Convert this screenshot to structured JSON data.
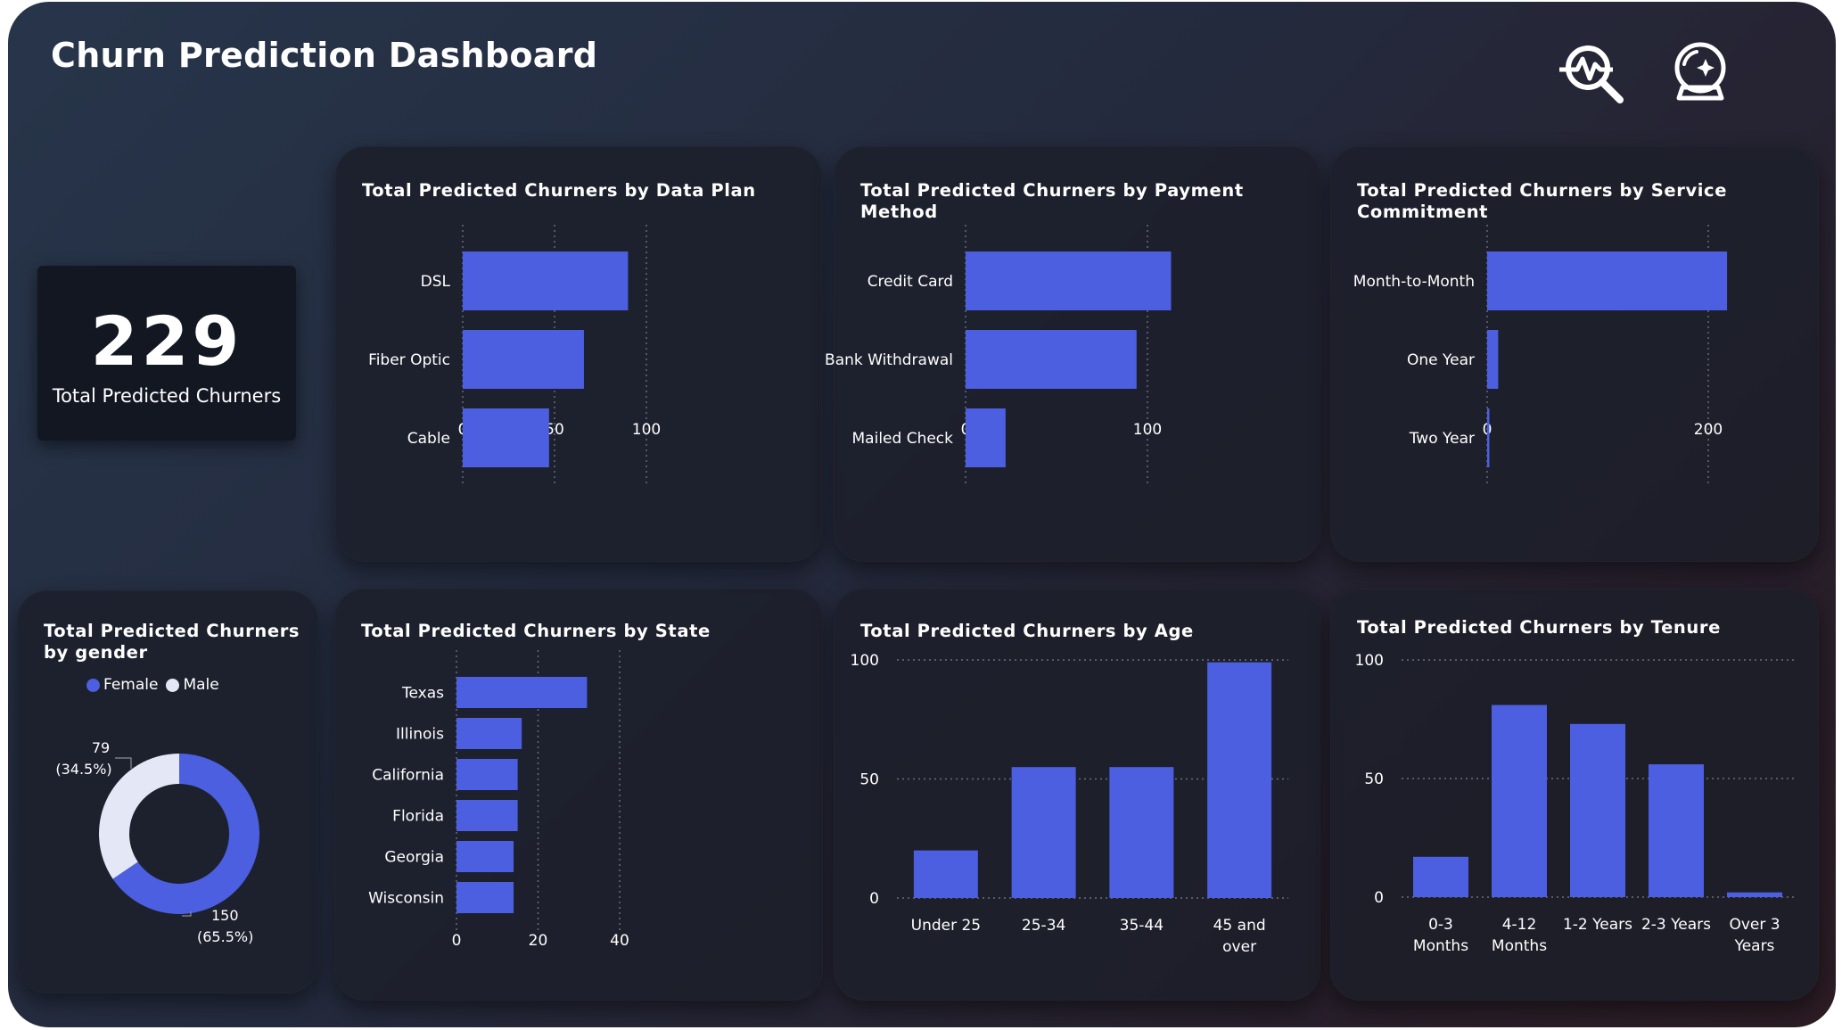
{
  "dashboard": {
    "title": "Churn Prediction Dashboard",
    "icons": [
      "heartbeat-search-icon",
      "crystal-ball-icon"
    ]
  },
  "kpi": {
    "value": "229",
    "label": "Total Predicted Churners"
  },
  "colors": {
    "bar": "#4b5fe0",
    "male": "#e4e7f6",
    "grid": "#6b6f80"
  },
  "chart_data": [
    {
      "id": "data_plan",
      "type": "bar",
      "orientation": "horizontal",
      "title": "Total Predicted Churners by Data Plan",
      "categories": [
        "DSL",
        "Fiber Optic",
        "Cable"
      ],
      "values": [
        90,
        66,
        47
      ],
      "xlim": [
        0,
        100
      ],
      "xticks": [
        0,
        50,
        100
      ],
      "grid": true
    },
    {
      "id": "payment_method",
      "type": "bar",
      "orientation": "horizontal",
      "title": "Total Predicted Churners by Payment Method",
      "categories": [
        "Credit Card",
        "Bank Withdrawal",
        "Mailed Check"
      ],
      "values": [
        113,
        94,
        22
      ],
      "xlim": [
        0,
        100
      ],
      "xticks": [
        0,
        100
      ],
      "grid": true
    },
    {
      "id": "service_commitment",
      "type": "bar",
      "orientation": "horizontal",
      "title": "Total Predicted Churners by Service Commitment",
      "categories": [
        "Month-to-Month",
        "One Year",
        "Two Year"
      ],
      "values": [
        217,
        10,
        2
      ],
      "xlim": [
        0,
        200
      ],
      "xticks": [
        0,
        200
      ],
      "grid": true
    },
    {
      "id": "gender",
      "type": "pie",
      "donut": true,
      "title": "Total Predicted Churners by gender",
      "legend": [
        "Female",
        "Male"
      ],
      "slices": [
        {
          "label": "Female",
          "value": 150,
          "pct": "65.5%"
        },
        {
          "label": "Male",
          "value": 79,
          "pct": "34.5%"
        }
      ]
    },
    {
      "id": "state",
      "type": "bar",
      "orientation": "horizontal",
      "title": "Total Predicted Churners by State",
      "categories": [
        "Texas",
        "Illinois",
        "California",
        "Florida",
        "Georgia",
        "Wisconsin"
      ],
      "values": [
        32,
        16,
        15,
        15,
        14,
        14
      ],
      "xlim": [
        0,
        40
      ],
      "xticks": [
        0,
        20,
        40
      ],
      "grid": true
    },
    {
      "id": "age",
      "type": "bar",
      "orientation": "vertical",
      "title": "Total Predicted Churners by Age",
      "categories": [
        "Under 25",
        "25-34",
        "35-44",
        "45 and over"
      ],
      "values": [
        20,
        55,
        55,
        99
      ],
      "ylim": [
        0,
        100
      ],
      "yticks": [
        0,
        50,
        100
      ],
      "grid": true
    },
    {
      "id": "tenure",
      "type": "bar",
      "orientation": "vertical",
      "title": "Total Predicted Churners by Tenure",
      "categories": [
        "0-3 Months",
        "4-12 Months",
        "1-2 Years",
        "2-3 Years",
        "Over 3 Years"
      ],
      "values": [
        17,
        81,
        73,
        56,
        2
      ],
      "ylim": [
        0,
        100
      ],
      "yticks": [
        0,
        50,
        100
      ],
      "grid": true
    }
  ]
}
